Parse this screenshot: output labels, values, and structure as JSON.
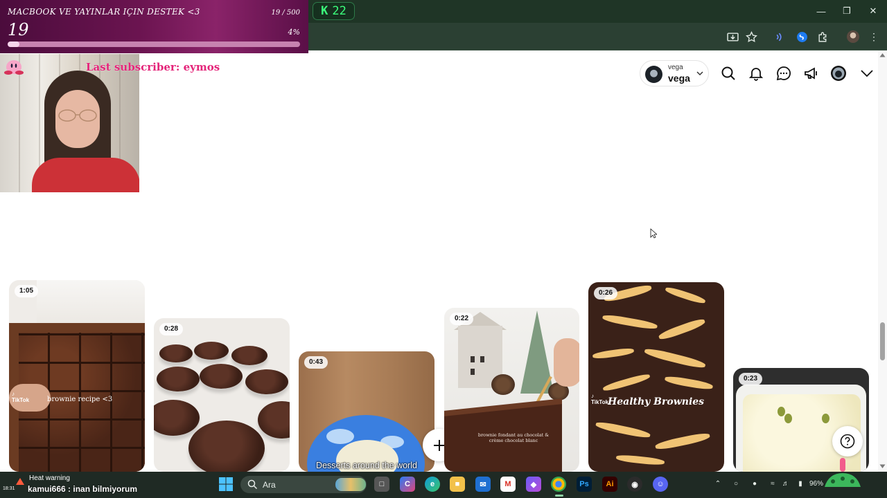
{
  "overlay": {
    "goal_title": "MACBOOK VE YAYINLAR IÇIN DESTEK <3",
    "goal_current": "19",
    "goal_ratio": "19 / 500",
    "goal_percent_label": "4%",
    "goal_progress": 0.04,
    "last_subscriber": "Last subscriber: eymos",
    "chat_message": "kamui666 : inan bilmiyorum",
    "heat_warning": "Heat warning"
  },
  "browser": {
    "counter_badge": "22"
  },
  "header": {
    "account_small": "vega",
    "account_name": "vega"
  },
  "pins": [
    {
      "duration": "1:05",
      "overlay_text": "brownie recipe <3",
      "source": "TikTok"
    },
    {
      "duration": "0:28"
    },
    {
      "duration": "0:43",
      "caption": "Desserts around the world"
    },
    {
      "duration": "0:22",
      "overlay_text": "brownie fondant au chocolat & crème chocolat blanc"
    },
    {
      "duration": "0:26",
      "overlay_text": "Healthy Brownies",
      "source": "TikTok"
    },
    {
      "duration": "0:23"
    }
  ],
  "taskbar": {
    "search_label": "Ara",
    "clock": "18:31",
    "battery": "96%"
  },
  "icons": [
    "download-icon",
    "star-icon",
    "extension-icon",
    "search-icon",
    "bell-icon",
    "message-icon",
    "megaphone-icon",
    "chevron-down-icon",
    "plus-icon",
    "help-icon"
  ]
}
